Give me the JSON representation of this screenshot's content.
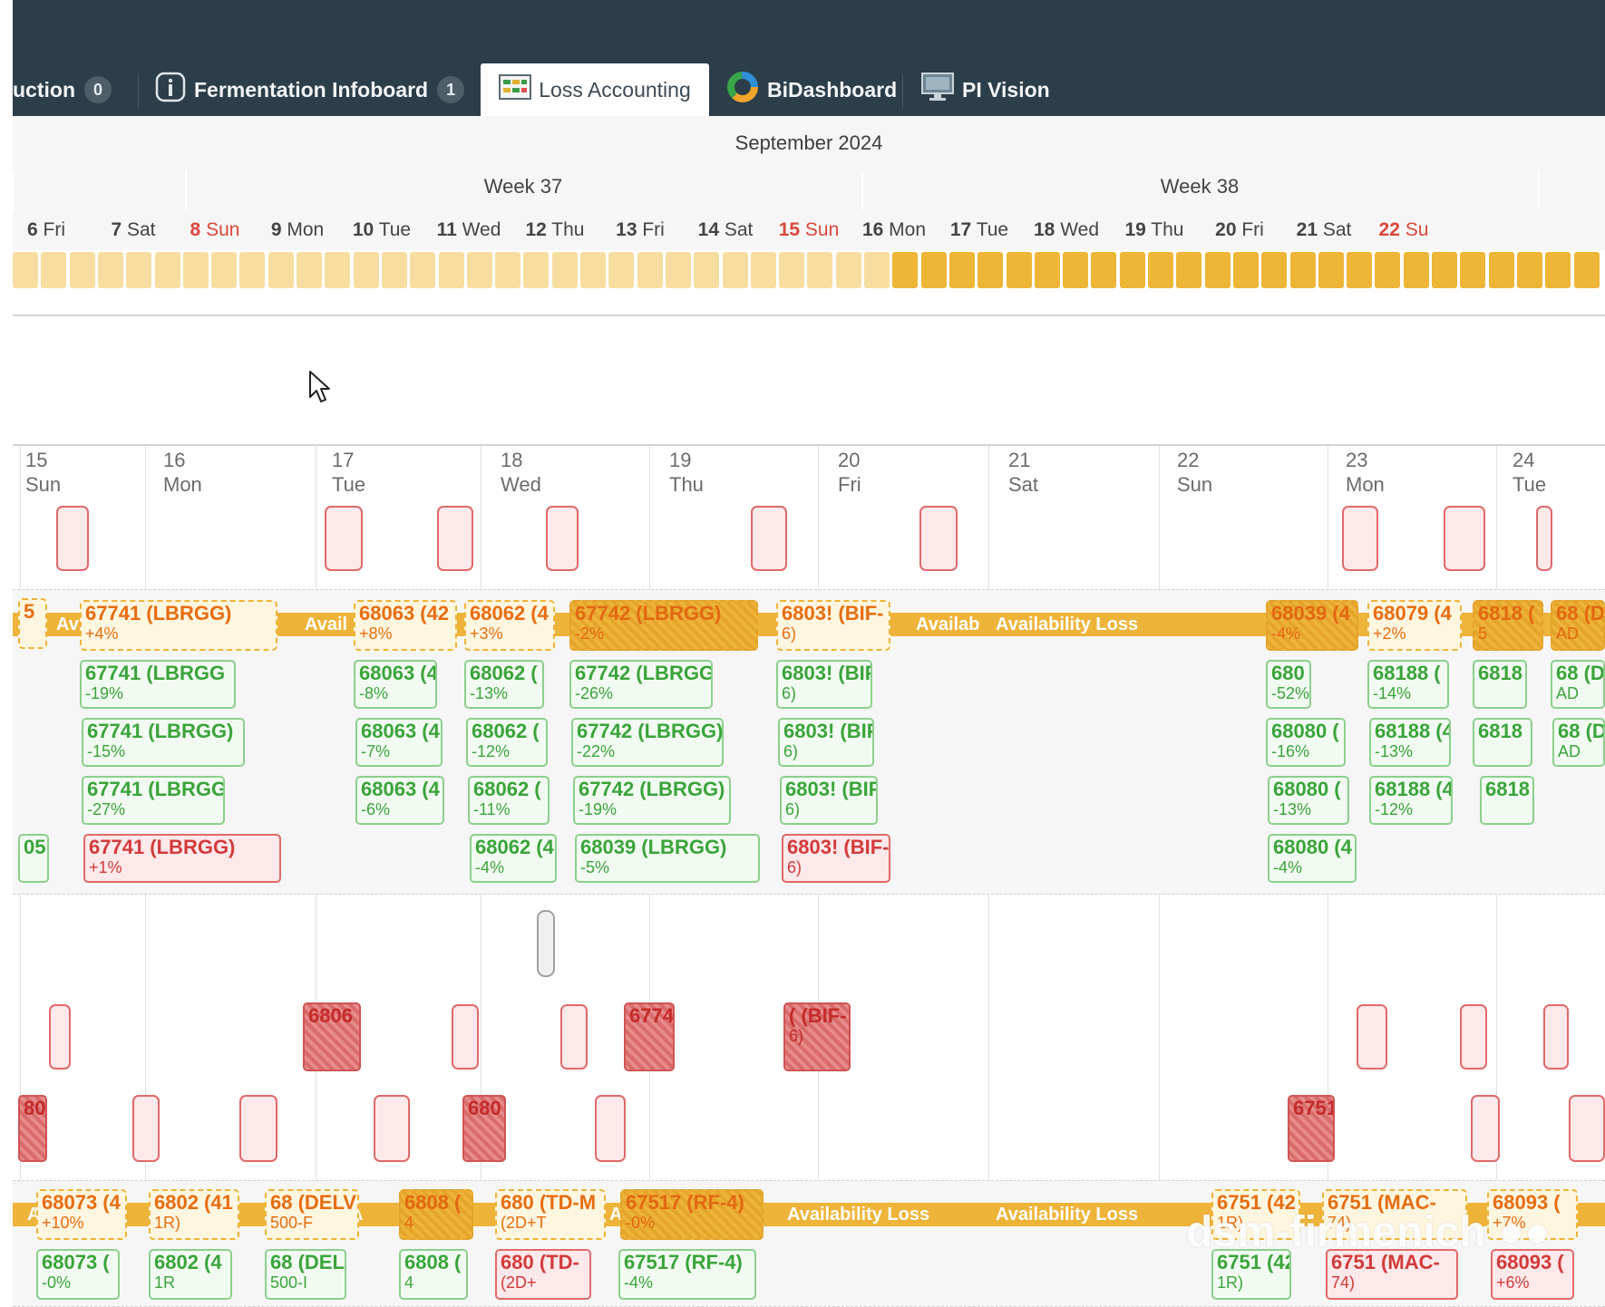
{
  "tabs": [
    {
      "label": "uction",
      "badge": "0",
      "icon": "production-icon"
    },
    {
      "label": "Fermentation Infoboard",
      "badge": "1",
      "icon": "info-icon"
    },
    {
      "label": "Loss Accounting",
      "active": true,
      "icon": "table-chart-icon"
    },
    {
      "label": "BiDashboard",
      "icon": "donut-chart-icon"
    },
    {
      "label": "PI Vision",
      "icon": "monitor-icon"
    }
  ],
  "calendar": {
    "month": "September 2024",
    "weeks": [
      "Week 37",
      "Week 38"
    ],
    "days": [
      {
        "num": "6",
        "dow": "Fri"
      },
      {
        "num": "7",
        "dow": "Sat"
      },
      {
        "num": "8",
        "dow": "Sun"
      },
      {
        "num": "9",
        "dow": "Mon"
      },
      {
        "num": "10",
        "dow": "Tue"
      },
      {
        "num": "11",
        "dow": "Wed"
      },
      {
        "num": "12",
        "dow": "Thu"
      },
      {
        "num": "13",
        "dow": "Fri"
      },
      {
        "num": "14",
        "dow": "Sat"
      },
      {
        "num": "15",
        "dow": "Sun"
      },
      {
        "num": "16",
        "dow": "Mon"
      },
      {
        "num": "17",
        "dow": "Tue"
      },
      {
        "num": "18",
        "dow": "Wed"
      },
      {
        "num": "19",
        "dow": "Thu"
      },
      {
        "num": "20",
        "dow": "Fri"
      },
      {
        "num": "21",
        "dow": "Sat"
      },
      {
        "num": "22",
        "dow": "Su"
      }
    ]
  },
  "timeline": {
    "days": [
      {
        "num": "15",
        "dow": "Sun"
      },
      {
        "num": "16",
        "dow": "Mon"
      },
      {
        "num": "17",
        "dow": "Tue"
      },
      {
        "num": "18",
        "dow": "Wed"
      },
      {
        "num": "19",
        "dow": "Thu"
      },
      {
        "num": "20",
        "dow": "Fri"
      },
      {
        "num": "21",
        "dow": "Sat"
      },
      {
        "num": "22",
        "dow": "Sun"
      },
      {
        "num": "23",
        "dow": "Mon"
      },
      {
        "num": "24",
        "dow": "Tue"
      }
    ],
    "bar1_labels": [
      "Av",
      "Avail",
      "Availab",
      "Availability Loss"
    ],
    "bar2_labels": [
      "A",
      "A",
      "A",
      "Availability Loss",
      "Availability Loss"
    ],
    "band1": {
      "row1": [
        {
          "t": "5",
          "s": ""
        },
        {
          "t": "67741 (LBRGG)",
          "s": "+4%"
        },
        {
          "t": "68063 (42",
          "s": "+8%"
        },
        {
          "t": "68062 (4",
          "s": "+3%"
        },
        {
          "t": "67742 (LBRGG)",
          "s": "-2%"
        },
        {
          "t": "6803! (BIF-",
          "s": "6)"
        },
        {
          "t": "68039 (4",
          "s": "-4%"
        },
        {
          "t": "68079 (4",
          "s": "+2%"
        },
        {
          "t": "6818 (",
          "s": "5"
        },
        {
          "t": "68 (D",
          "s": "AD"
        }
      ],
      "row2": [
        {
          "t": "67741 (LBRGG",
          "s": "-19%"
        },
        {
          "t": "68063 (4",
          "s": "-8%"
        },
        {
          "t": "68062 (",
          "s": "-13%"
        },
        {
          "t": "67742 (LBRGG",
          "s": "-26%"
        },
        {
          "t": "6803! (BIF",
          "s": "6)"
        },
        {
          "t": "680",
          "s": "-52%"
        },
        {
          "t": "68188 (",
          "s": "-14%"
        },
        {
          "t": "6818",
          "s": ""
        },
        {
          "t": "68 (D",
          "s": "AD"
        }
      ],
      "row3": [
        {
          "t": "67741 (LBRGG)",
          "s": "-15%"
        },
        {
          "t": "68063 (4",
          "s": "-7%"
        },
        {
          "t": "68062 (",
          "s": "-12%"
        },
        {
          "t": "67742 (LBRGG)",
          "s": "-22%"
        },
        {
          "t": "6803! (BIF",
          "s": "6)"
        },
        {
          "t": "68080 (",
          "s": "-16%"
        },
        {
          "t": "68188 (4",
          "s": "-13%"
        },
        {
          "t": "6818",
          "s": ""
        },
        {
          "t": "68 (D",
          "s": "AD"
        }
      ],
      "row4": [
        {
          "t": "67741 (LBRGG",
          "s": "-27%"
        },
        {
          "t": "68063 (4",
          "s": "-6%"
        },
        {
          "t": "68062 (",
          "s": "-11%"
        },
        {
          "t": "67742 (LBRGG)",
          "s": "-19%"
        },
        {
          "t": "6803! (BIF",
          "s": "6)"
        },
        {
          "t": "68080 (",
          "s": "-13%"
        },
        {
          "t": "68188 (4",
          "s": "-12%"
        },
        {
          "t": "6818",
          "s": ""
        }
      ],
      "row5": [
        {
          "t": "05",
          "s": ""
        },
        {
          "t": "67741 (LBRGG)",
          "s": "+1%"
        },
        {
          "t": "68062 (4",
          "s": "-4%"
        },
        {
          "t": "68039 (LBRGG)",
          "s": "-5%"
        },
        {
          "t": "6803! (BIF-",
          "s": "6)"
        },
        {
          "t": "68080 (4",
          "s": "-4%"
        }
      ]
    },
    "hatch_blocks": [
      {
        "t": "6806"
      },
      {
        "t": "6774"
      },
      {
        "t": "( (BIF-",
        "s": "6)"
      },
      {
        "t": "80"
      },
      {
        "t": "680"
      },
      {
        "t": "6751"
      }
    ],
    "band2": {
      "row1": [
        {
          "t": "68073 (4",
          "s": "+10%"
        },
        {
          "t": "6802 (41",
          "s": "1R)"
        },
        {
          "t": "68 (DELV",
          "s": "500-F"
        },
        {
          "t": "6808 (",
          "s": "4"
        },
        {
          "t": "680 (TD-M",
          "s": "(2D+T"
        },
        {
          "t": "67517 (RF-4)",
          "s": "-0%"
        },
        {
          "t": "6751 (42",
          "s": "1R)"
        },
        {
          "t": "6751 (MAC-",
          "s": "74)"
        },
        {
          "t": "68093 (",
          "s": "+7%"
        }
      ],
      "row2": [
        {
          "t": "68073 (",
          "s": "-0%"
        },
        {
          "t": "6802 (4",
          "s": "1R"
        },
        {
          "t": "68 (DEL",
          "s": "500-I"
        },
        {
          "t": "6808 (",
          "s": "4"
        },
        {
          "t": "680 (TD-",
          "s": "(2D+"
        },
        {
          "t": "67517 (RF-4)",
          "s": "-4%"
        },
        {
          "t": "6751 (42",
          "s": "1R)"
        },
        {
          "t": "6751 (MAC-",
          "s": "74)"
        },
        {
          "t": "68093 (",
          "s": "+6%"
        }
      ]
    }
  },
  "watermark": "dsm-firmenich",
  "colors": {
    "topbar": "#2c3e4a",
    "availability_bar": "#eeb43a",
    "green_block": "#3aa43a",
    "red_block": "#d33a3a",
    "orange_text": "#e86c10",
    "sunday": "#d9473b"
  }
}
